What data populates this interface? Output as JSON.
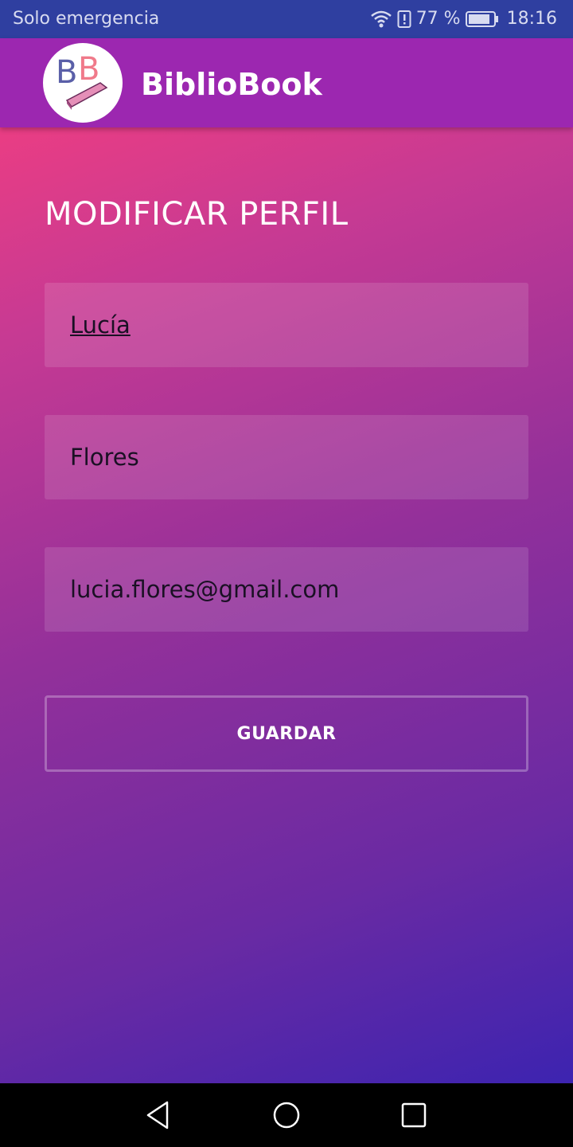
{
  "status_bar": {
    "carrier": "Solo emergencia",
    "battery": "77 %",
    "time": "18:16",
    "icons": [
      "wifi-icon",
      "alert-icon",
      "battery-icon"
    ]
  },
  "app_bar": {
    "title": "BiblioBook",
    "logo_icon": "bibliobook-logo"
  },
  "page": {
    "title": "MODIFICAR PERFIL"
  },
  "form": {
    "first_name": "Lucía",
    "last_name": "Flores",
    "email": "lucia.flores@gmail.com",
    "save_label": "GUARDAR"
  },
  "nav_bar": {
    "icons": [
      "back-icon",
      "home-icon",
      "recents-icon"
    ]
  },
  "colors": {
    "status_bar": "#2f3fa0",
    "app_bar": "#9c27b0",
    "gradient_start": "#ff3f7a",
    "gradient_end": "#3222b3"
  }
}
